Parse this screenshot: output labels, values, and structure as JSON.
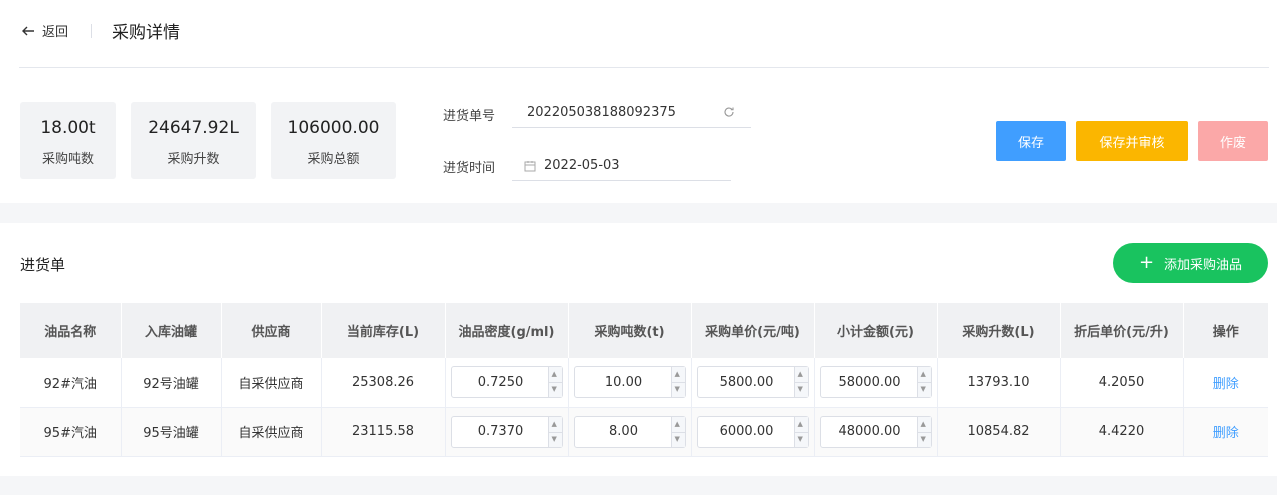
{
  "header": {
    "back_label": "返回",
    "title": "采购详情"
  },
  "stats": [
    {
      "value": "18.00t",
      "label": "采购吨数"
    },
    {
      "value": "24647.92L",
      "label": "采购升数"
    },
    {
      "value": "106000.00",
      "label": "采购总额"
    }
  ],
  "form": {
    "order_no_label": "进货单号",
    "order_no_value": "202205038188092375",
    "date_label": "进货时间",
    "date_value": "2022-05-03"
  },
  "actions": {
    "save": "保存",
    "save_audit": "保存并审核",
    "void": "作废"
  },
  "section": {
    "title": "进货单",
    "add_button": "添加采购油品"
  },
  "table": {
    "columns": [
      "油品名称",
      "入库油罐",
      "供应商",
      "当前库存(L)",
      "油品密度(g/ml)",
      "采购吨数(t)",
      "采购单价(元/吨)",
      "小计金额(元)",
      "采购升数(L)",
      "折后单价(元/升)",
      "操作"
    ],
    "rows": [
      {
        "name": "92#汽油",
        "tank": "92号油罐",
        "supplier": "自采供应商",
        "stock": "25308.26",
        "density": "0.7250",
        "tons": "10.00",
        "unit_price": "5800.00",
        "subtotal": "58000.00",
        "liters": "13793.10",
        "discount_price": "4.2050",
        "action": "删除"
      },
      {
        "name": "95#汽油",
        "tank": "95号油罐",
        "supplier": "自采供应商",
        "stock": "23115.58",
        "density": "0.7370",
        "tons": "8.00",
        "unit_price": "6000.00",
        "subtotal": "48000.00",
        "liters": "10854.82",
        "discount_price": "4.4220",
        "action": "删除"
      }
    ]
  },
  "colors": {
    "primary": "#409eff",
    "warning": "#fbb600",
    "danger_light": "#fba8a8",
    "success": "#19c35f"
  }
}
